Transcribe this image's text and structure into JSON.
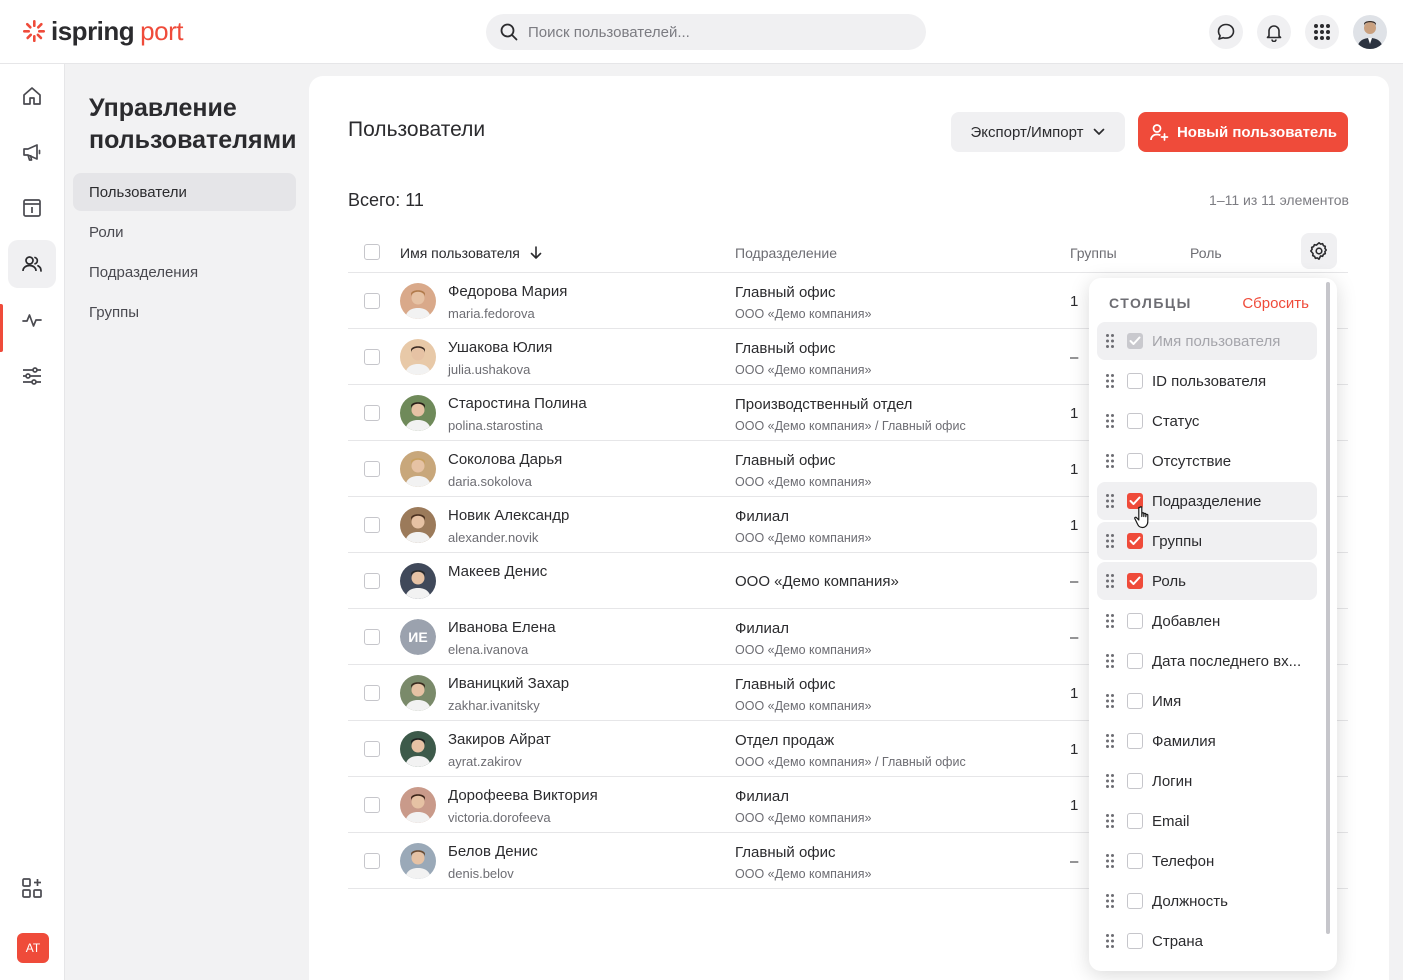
{
  "brand": {
    "name_bold": "ispring",
    "name_light": "port",
    "accent": "#ef4b3a"
  },
  "search": {
    "placeholder": "Поиск пользователей..."
  },
  "header": {
    "user_initials": "AT"
  },
  "sidebar": {
    "title": "Управление пользователями",
    "items": [
      {
        "label": "Пользователи",
        "active": true
      },
      {
        "label": "Роли"
      },
      {
        "label": "Подразделения"
      },
      {
        "label": "Группы"
      }
    ]
  },
  "main": {
    "title": "Пользователи",
    "export_label": "Экспорт/Импорт",
    "new_user_label": "Новый пользователь",
    "total_label": "Всего: 11",
    "range_label": "1–11 из 11 элементов",
    "columns": {
      "name": "Имя пользователя",
      "department": "Подразделение",
      "groups": "Группы",
      "role": "Роль"
    },
    "rows": [
      {
        "name": "Федорова Мария",
        "login": "maria.fedorova",
        "dept": "Главный офис",
        "org": "ООО «Демо компания»",
        "groups": "1",
        "avatar": "photo"
      },
      {
        "name": "Ушакова Юлия",
        "login": "julia.ushakova",
        "dept": "Главный офис",
        "org": "ООО «Демо компания»",
        "groups": "–",
        "avatar": "photo"
      },
      {
        "name": "Старостина Полина",
        "login": "polina.starostina",
        "dept": "Производственный отдел",
        "org": "ООО «Демо компания» / Главный офис",
        "groups": "1",
        "avatar": "photo"
      },
      {
        "name": "Соколова Дарья",
        "login": "daria.sokolova",
        "dept": "Главный офис",
        "org": "ООО «Демо компания»",
        "groups": "1",
        "avatar": "photo"
      },
      {
        "name": "Новик Александр",
        "login": "alexander.novik",
        "dept": "Филиал",
        "org": "ООО «Демо компания»",
        "groups": "1",
        "avatar": "photo"
      },
      {
        "name": "Макеев Денис",
        "login": "",
        "dept": "ООО «Демо компания»",
        "org": "",
        "groups": "–",
        "avatar": "photo"
      },
      {
        "name": "Иванова Елена",
        "login": "elena.ivanova",
        "dept": "Филиал",
        "org": "ООО «Демо компания»",
        "groups": "–",
        "avatar": "initials",
        "initials": "ИЕ"
      },
      {
        "name": "Иваницкий Захар",
        "login": "zakhar.ivanitsky",
        "dept": "Главный офис",
        "org": "ООО «Демо компания»",
        "groups": "1",
        "avatar": "photo"
      },
      {
        "name": "Закиров Айрат",
        "login": "ayrat.zakirov",
        "dept": "Отдел продаж",
        "org": "ООО «Демо компания» / Главный офис",
        "groups": "1",
        "avatar": "photo"
      },
      {
        "name": "Дорофеева Виктория",
        "login": "victoria.dorofeeva",
        "dept": "Филиал",
        "org": "ООО «Демо компания»",
        "groups": "1",
        "avatar": "photo"
      },
      {
        "name": "Белов Денис",
        "login": "denis.belov",
        "dept": "Главный офис",
        "org": "ООО «Демо компания»",
        "groups": "–",
        "avatar": "photo"
      }
    ]
  },
  "columns_popup": {
    "title": "СТОЛБЦЫ",
    "reset_label": "Сбросить",
    "items": [
      {
        "label": "Имя пользователя",
        "state": "disabled"
      },
      {
        "label": "ID пользователя",
        "state": "off"
      },
      {
        "label": "Статус",
        "state": "off"
      },
      {
        "label": "Отсутствие",
        "state": "off"
      },
      {
        "label": "Подразделение",
        "state": "on"
      },
      {
        "label": "Группы",
        "state": "on"
      },
      {
        "label": "Роль",
        "state": "on"
      },
      {
        "label": "Добавлен",
        "state": "off"
      },
      {
        "label": "Дата последнего вх...",
        "state": "off"
      },
      {
        "label": "Имя",
        "state": "off"
      },
      {
        "label": "Фамилия",
        "state": "off"
      },
      {
        "label": "Логин",
        "state": "off"
      },
      {
        "label": "Email",
        "state": "off"
      },
      {
        "label": "Телефон",
        "state": "off"
      },
      {
        "label": "Должность",
        "state": "off"
      },
      {
        "label": "Страна",
        "state": "off"
      }
    ]
  }
}
